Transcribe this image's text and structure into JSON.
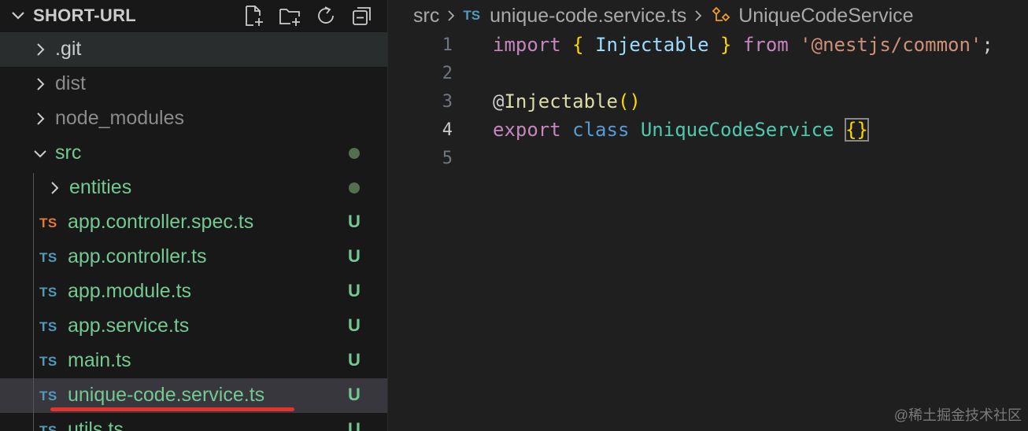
{
  "explorer": {
    "title": "SHORT-URL",
    "action_icons": [
      "new-file-icon",
      "new-folder-icon",
      "refresh-icon",
      "collapse-all-icon"
    ]
  },
  "tree": [
    {
      "kind": "folder",
      "label": ".git",
      "expanded": false,
      "dimmed": false
    },
    {
      "kind": "folder",
      "label": "dist",
      "expanded": false,
      "dimmed": true
    },
    {
      "kind": "folder",
      "label": "node_modules",
      "expanded": false,
      "dimmed": true
    },
    {
      "kind": "folder",
      "label": "src",
      "expanded": true,
      "color": "green",
      "status": "dot"
    },
    {
      "kind": "folder",
      "label": "entities",
      "expanded": false,
      "color": "green",
      "status": "dot"
    },
    {
      "kind": "file",
      "icon": "TS",
      "icon_color": "orange",
      "label": "app.controller.spec.ts",
      "status": "U"
    },
    {
      "kind": "file",
      "icon": "TS",
      "icon_color": "blue",
      "label": "app.controller.ts",
      "status": "U"
    },
    {
      "kind": "file",
      "icon": "TS",
      "icon_color": "blue",
      "label": "app.module.ts",
      "status": "U"
    },
    {
      "kind": "file",
      "icon": "TS",
      "icon_color": "blue",
      "label": "app.service.ts",
      "status": "U"
    },
    {
      "kind": "file",
      "icon": "TS",
      "icon_color": "blue",
      "label": "main.ts",
      "status": "U"
    },
    {
      "kind": "file",
      "icon": "TS",
      "icon_color": "blue",
      "label": "unique-code.service.ts",
      "status": "U",
      "selected": true
    },
    {
      "kind": "file",
      "icon": "TS",
      "icon_color": "blue",
      "label": "utils.ts",
      "status": "U"
    }
  ],
  "breadcrumbs": {
    "folder": "src",
    "file_icon": "TS",
    "file": "unique-code.service.ts",
    "symbol": "UniqueCodeService"
  },
  "editor": {
    "active_line": 4,
    "lines": [
      {
        "n": "1",
        "tokens": [
          {
            "t": "import",
            "c": "kw"
          },
          {
            "t": " ",
            "c": "plain"
          },
          {
            "t": "{",
            "c": "br"
          },
          {
            "t": " ",
            "c": "plain"
          },
          {
            "t": "Injectable",
            "c": "ident"
          },
          {
            "t": " ",
            "c": "plain"
          },
          {
            "t": "}",
            "c": "br"
          },
          {
            "t": " ",
            "c": "plain"
          },
          {
            "t": "from",
            "c": "kw"
          },
          {
            "t": " ",
            "c": "plain"
          },
          {
            "t": "'@nestjs/common'",
            "c": "str"
          },
          {
            "t": ";",
            "c": "plain"
          }
        ]
      },
      {
        "n": "2",
        "tokens": []
      },
      {
        "n": "3",
        "tokens": [
          {
            "t": "@",
            "c": "plain"
          },
          {
            "t": "Injectable",
            "c": "fn"
          },
          {
            "t": "()",
            "c": "br"
          }
        ]
      },
      {
        "n": "4",
        "tokens": [
          {
            "t": "export",
            "c": "kw"
          },
          {
            "t": " ",
            "c": "plain"
          },
          {
            "t": "class",
            "c": "kw2"
          },
          {
            "t": " ",
            "c": "plain"
          },
          {
            "t": "UniqueCodeService",
            "c": "cls"
          },
          {
            "t": " ",
            "c": "plain"
          },
          {
            "t": "{}",
            "c": "br bracketbox"
          }
        ]
      },
      {
        "n": "5",
        "tokens": []
      }
    ]
  },
  "watermark": "@稀土掘金技术社区",
  "colors": {
    "sidebar_bg": "#181818",
    "editor_bg": "#1f1f1f",
    "selection": "#37373d",
    "untracked_green": "#73c991",
    "ts_blue": "#519aba",
    "ts_orange": "#e37933",
    "annotation_red": "#e5322d"
  }
}
